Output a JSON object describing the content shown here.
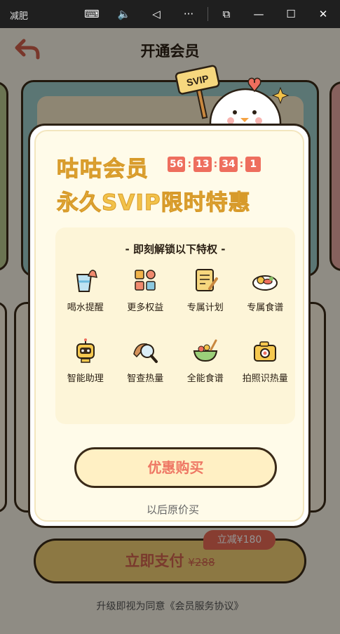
{
  "window": {
    "app_title": "减肥",
    "icons": [
      "keyboard-icon",
      "volume-icon",
      "back-triangle-icon",
      "more-icon",
      "snap-icon",
      "minimize-icon",
      "maximize-icon",
      "close-icon"
    ],
    "glyphs": {
      "keyboard": "⌨",
      "volume": "🔈",
      "back": "◁",
      "more": "···",
      "snap": "⧉",
      "minimize": "—",
      "maximize": "☐",
      "close": "✕"
    }
  },
  "page": {
    "title": "开通会员",
    "pay_button": {
      "label": "立即支付",
      "original_price": "¥288"
    },
    "discount_tag": "立减¥180",
    "agreement": "升级即视为同意《会员服务协议》"
  },
  "modal": {
    "title": "咕咕会员",
    "subtitle": "永久SVIP限时特惠",
    "badge": "SVIP",
    "countdown": [
      "56",
      "13",
      "34",
      "1"
    ],
    "perks_heading": "- 即刻解锁以下特权 -",
    "perks": [
      {
        "name": "喝水提醒",
        "icon": "water-cup-icon"
      },
      {
        "name": "更多权益",
        "icon": "grid-icon"
      },
      {
        "name": "专属计划",
        "icon": "plan-document-icon"
      },
      {
        "name": "专属食谱",
        "icon": "food-plate-icon"
      },
      {
        "name": "智能助理",
        "icon": "robot-icon"
      },
      {
        "name": "智查热量",
        "icon": "magnifier-food-icon"
      },
      {
        "name": "全能食谱",
        "icon": "salad-bowl-icon"
      },
      {
        "name": "拍照识热量",
        "icon": "camera-icon"
      }
    ],
    "buy_button": "优惠购买",
    "later_link": "以后原价买"
  },
  "colors": {
    "accent_yellow": "#f2c24a",
    "accent_red": "#ee6e5e",
    "outline": "#2b2014"
  }
}
